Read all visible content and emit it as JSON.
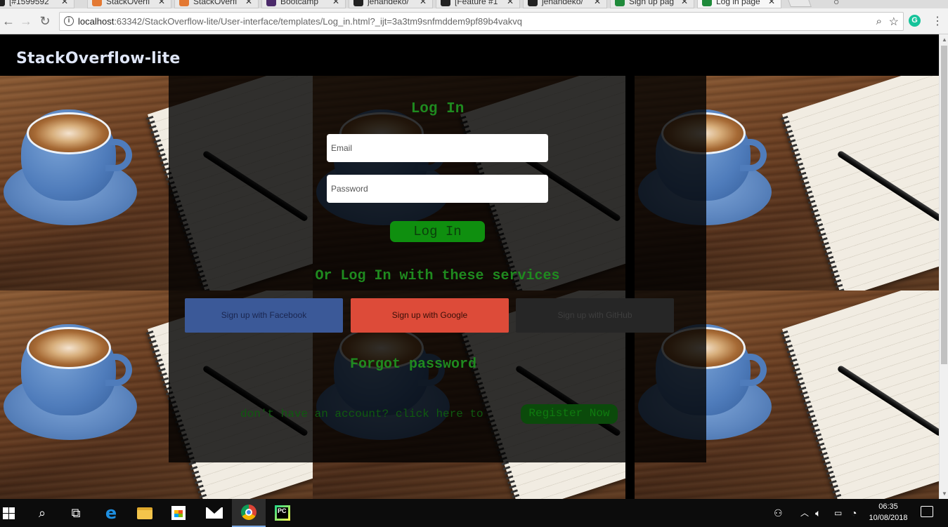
{
  "browser": {
    "tabs": [
      {
        "label": "[#1599592",
        "color": "#333333"
      },
      {
        "label": "StackOverfl",
        "color": "#e37933"
      },
      {
        "label": "StackOverfl",
        "color": "#e37933"
      },
      {
        "label": "Bootcamp",
        "color": "#4b2a6a"
      },
      {
        "label": "jehandeko/",
        "color": "#333333"
      },
      {
        "label": "[Feature #1",
        "color": "#333333"
      },
      {
        "label": "jehandeko/",
        "color": "#333333"
      },
      {
        "label": "Sign up pag",
        "color": "#1f8a3a"
      },
      {
        "label": "Log in page",
        "color": "#1f8a3a"
      }
    ],
    "url_host": "localhost",
    "url_rest": ":63342/StackOverflow-lite/User-interface/templates/Log_in.html?_ijt=3a3tm9snfmddem9pf89b4vakvq"
  },
  "page": {
    "brand": "StackOverflow-lite",
    "login_title": "Log In",
    "email_placeholder": "Email",
    "password_placeholder": "Password",
    "login_button": "Log In",
    "or_text": "Or Log In with these services",
    "facebook_button": "Sign up with Facebook",
    "google_button": "Sign up with Google",
    "github_button": "Sign up with GitHub",
    "forgot_password": "Forgot password",
    "no_account_text": "don't have an account? click here to",
    "register_button": "Register Now"
  },
  "taskbar": {
    "time": "06:35",
    "date": "10/08/2018"
  },
  "colors": {
    "accent_green": "#1f8a1f",
    "facebook": "#3b5998",
    "google": "#dd4b39",
    "github": "#262626"
  }
}
